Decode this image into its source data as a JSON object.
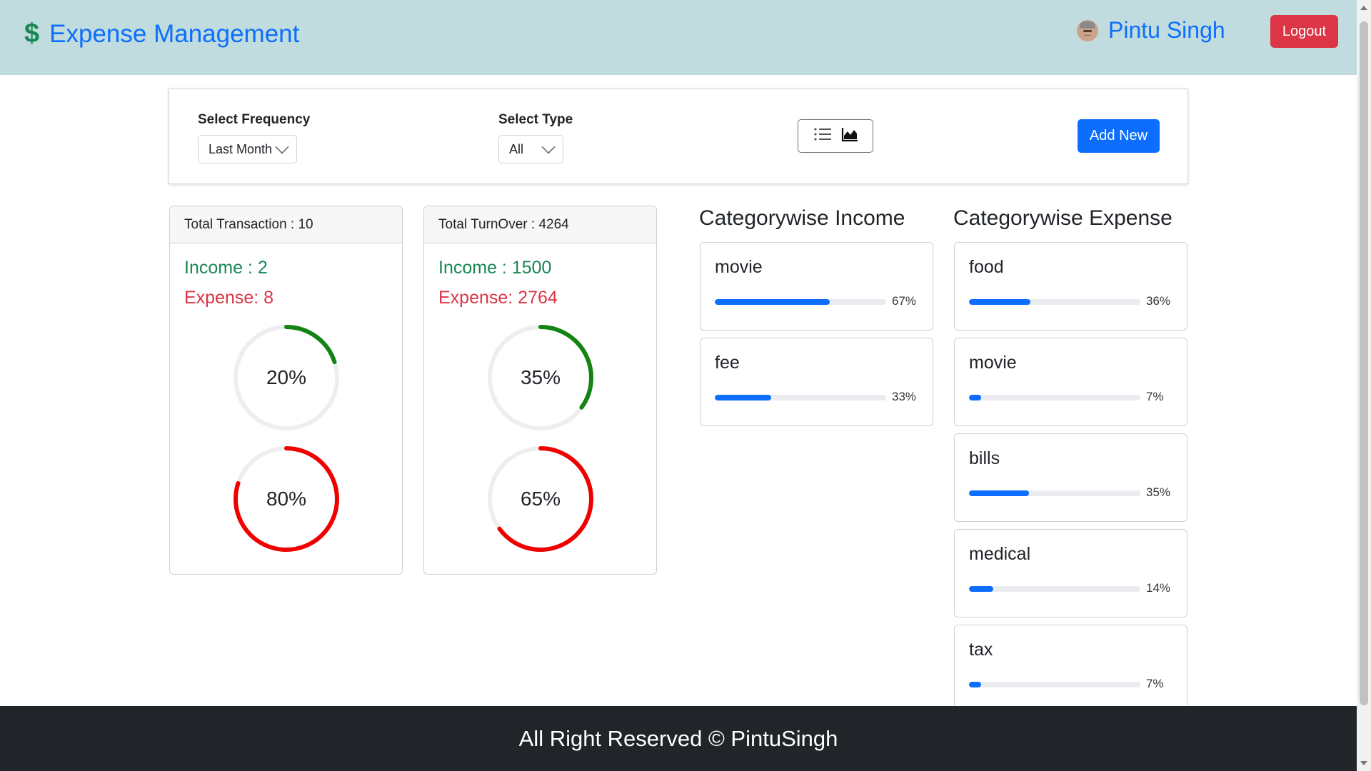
{
  "header": {
    "brand_symbol": "$",
    "brand": "Expense Management",
    "user_name": "Pintu Singh",
    "logout_label": "Logout"
  },
  "filters": {
    "frequency_label": "Select Frequency",
    "frequency_value": "Last Month",
    "type_label": "Select Type",
    "type_value": "All",
    "view_icons": [
      "list-icon",
      "area-chart-icon"
    ],
    "add_label": "Add New"
  },
  "transactions": {
    "title": "Total Transaction : 10",
    "income": "Income : 2",
    "expense": "Expense: 8",
    "income_pct": 20,
    "expense_pct": 80,
    "income_label": "20%",
    "expense_label": "80%"
  },
  "turnover": {
    "title": "Total TurnOver : 4264",
    "income": "Income : 1500",
    "expense": "Expense: 2764",
    "income_pct": 35,
    "expense_pct": 65,
    "income_label": "35%",
    "expense_label": "65%"
  },
  "income_categories": {
    "heading": "Categorywise Income",
    "items": [
      {
        "name": "movie",
        "percent": 67,
        "label": "67%"
      },
      {
        "name": "fee",
        "percent": 33,
        "label": "33%"
      }
    ]
  },
  "expense_categories": {
    "heading": "Categorywise Expense",
    "items": [
      {
        "name": "food",
        "percent": 36,
        "label": "36%"
      },
      {
        "name": "movie",
        "percent": 7,
        "label": "7%"
      },
      {
        "name": "bills",
        "percent": 35,
        "label": "35%"
      },
      {
        "name": "medical",
        "percent": 14,
        "label": "14%"
      },
      {
        "name": "tax",
        "percent": 7,
        "label": "7%"
      }
    ]
  },
  "footer": {
    "text": "All Right Reserved © PintuSingh"
  },
  "colors": {
    "income_ring": "#138313",
    "expense_ring": "#f00000",
    "ring_track": "#eeeeee",
    "primary": "#0d6efd",
    "danger": "#dc3545",
    "success": "#198754",
    "header_bg": "#c0dcde"
  }
}
